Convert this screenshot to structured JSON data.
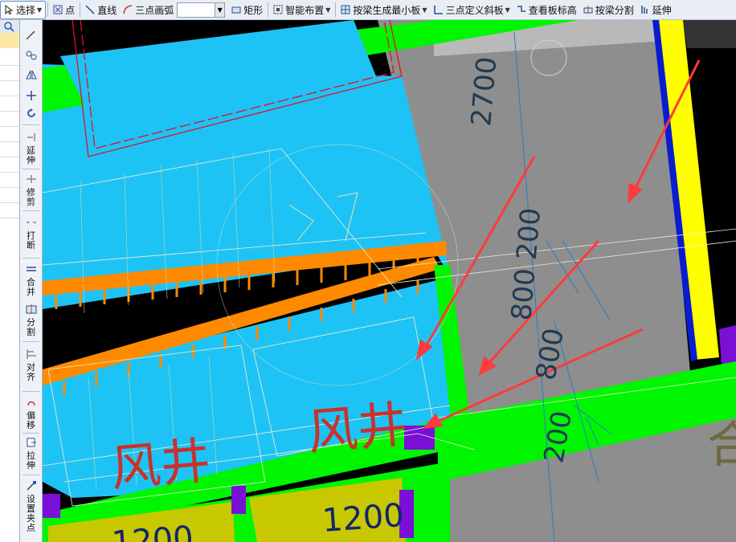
{
  "toolbar": {
    "select": "选择",
    "point": "点",
    "line": "直线",
    "arc": "三点画弧",
    "rect": "矩形",
    "smart_layout": "智能布置",
    "beam_min_slab": "按梁生成最小板",
    "three_point_slope": "三点定义斜板",
    "view_slab_elev": "查看板标高",
    "beam_split": "按梁分割",
    "extend": "延伸"
  },
  "side_tools": {
    "extend": "延伸",
    "trim": "修剪",
    "break": "打断",
    "merge": "合并",
    "split": "分割",
    "align": "对齐",
    "offset": "偏移",
    "stretch": "拉伸",
    "set_grip": "设置夹点"
  },
  "drawing": {
    "shaft_label_1": "风井",
    "shaft_label_2": "风井",
    "dim_2700": "2700",
    "dim_800_200": "800 200",
    "dim_200": "200",
    "dim_1200": "1200",
    "dim_partial": "1200",
    "corner_char": "合"
  },
  "colors": {
    "background": "#000000",
    "slab_blue": "#1ec3f5",
    "slab_gray": "#8e8e8e",
    "beam_green": "#00f500",
    "wall_yellow": "#ffff00",
    "stair_orange": "#ff8a00",
    "arrow_red": "#ff3b3b",
    "text_red": "#c8322a",
    "column_purple": "#7a10d6",
    "dimension_text": "#1f3a52"
  }
}
